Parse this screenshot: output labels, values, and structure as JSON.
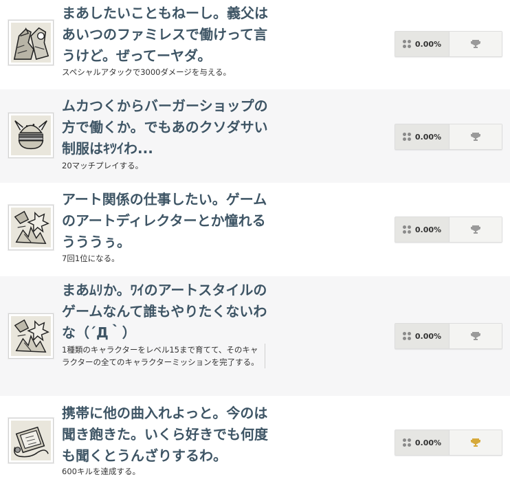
{
  "achievements": [
    {
      "title": "まあしたいこともねーし。義父はあいつのファミレスで働けって言うけど。ぜってーヤダ。",
      "description": "スペシャルアタックで3000ダメージを与える。",
      "percent": "0.00%",
      "icon": "dog-cowboy-sketch-icon",
      "trophy_color": "#9a9a9a"
    },
    {
      "title": "ムカつくからバーガーショップの方で働くか。でもあのクソダサい制服はｷﾂｲわ...",
      "description": "20マッチプレイする。",
      "percent": "0.00%",
      "icon": "viking-burger-sketch-icon",
      "trophy_color": "#9a9a9a"
    },
    {
      "title": "アート関係の仕事したい。ゲームのアートディレクターとか憧れるうううぅ。",
      "description": "7回1位になる。",
      "percent": "0.00%",
      "icon": "art-splash-sketch-icon",
      "trophy_color": "#9a9a9a"
    },
    {
      "title": "まあﾑﾘか。ﾜｲのアートスタイルのゲームなんて誰もやりたくないわな（´Д｀）",
      "description": "1種類のキャラクターをレベル15まで育てて、そのキャラクターの全てのキャラクターミッションを完了する。",
      "percent": "0.00%",
      "icon": "art-splash-sketch-icon",
      "trophy_color": "#9a9a9a"
    },
    {
      "title": "携帯に他の曲入れよっと。今のは聞き飽きた。いくら好きでも何度も聞くとうんざりするわ。",
      "description": "600キルを達成する。",
      "percent": "0.00%",
      "icon": "phone-headphones-sketch-icon",
      "trophy_color": "#d6a93a"
    }
  ]
}
